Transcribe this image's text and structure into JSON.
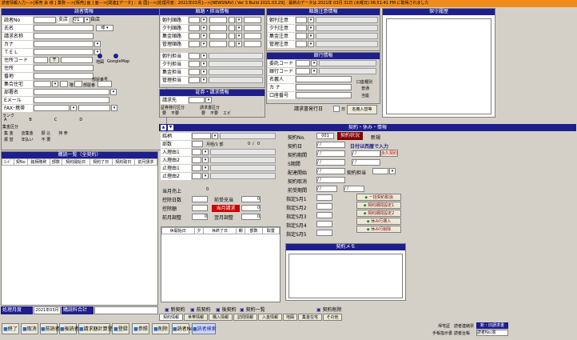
{
  "titlebar": "読者情報入力--->[販売 会 様 ] 業務 --->[販売] 画 ] 面--->[関連][データ] ：会 国]--->[処理月度：2021年03月]--->[NEWSNAVI / Ver 3 Build 2021.03.29]　最新のデータは 2021年 03月 31日 (水曜日) 06:51:41 PM に取得されました",
  "reader_panel": {
    "header": "読者情報",
    "reader_no": "読者No",
    "branch": "支店",
    "branch_code": "01",
    "branch_name": "自店",
    "name": "氏名",
    "customer_name": "請求名称",
    "kana": "カナ",
    "tel": "ＴＥＬ",
    "address_code": "住所コード",
    "postal": "〒",
    "address": "住所",
    "lot": "番地",
    "apt": "集合住宅",
    "floor": "階",
    "room": "部屋番",
    "room_no": "部屋番号",
    "dept": "部署名",
    "email": "Eメール",
    "fax": "FAX･携帯",
    "googlemap": "GoogleMap",
    "address_sub": "地図",
    "rank": "ランク",
    "rank_opts": [
      "A",
      "B",
      "C",
      "D"
    ],
    "collect": "集金区分",
    "collect_opts": [
      "集 金",
      "店集金",
      "振 込",
      "持 参",
      "振 替",
      "年払い",
      "不 要"
    ]
  },
  "delivery_panel": {
    "header": "順路・担当情報",
    "rows": [
      "朝刊順路",
      "夕刊順路",
      "集金順路",
      "管理順路",
      "朝刊担当",
      "夕刊担当",
      "集金担当",
      "管理担当"
    ]
  },
  "notes_panel": {
    "header": "順路注意情報",
    "rows": [
      "朝刊注意",
      "夕刊注意",
      "集金注意",
      "管理注意"
    ]
  },
  "keep_panel": {
    "header": "保守履歴"
  },
  "bank_panel": {
    "header": "銀行情報",
    "rows": [
      "委託コード",
      "銀行コード",
      "名義人",
      "カ ナ",
      "口座番号"
    ],
    "acct_type": "口座種別",
    "acct_opts": [
      "普通",
      "当座"
    ]
  },
  "bill_panel": {
    "header": "証券・請求情報",
    "bill_to": "請求先",
    "sec_issue": "証券発行区分",
    "bill_type": "請求書区分",
    "opt_need": "要",
    "opt_no": "不要",
    "opt_ebi": "エビ",
    "bill_issue_day": "請求書発行日",
    "day": "日",
    "name_input": "名義入替等"
  },
  "contract_header": "契約・休み・情報",
  "contract": {
    "brand": "銘柄",
    "dept": "部数",
    "monthly": "月極/1 部",
    "zero_a": "0",
    "slash": "/",
    "zero_b": "0",
    "in1": "入理由1",
    "in2": "入理由2",
    "stop1": "止理由1",
    "stop2": "止理由2",
    "current_sales": "当月売上",
    "current_val": "0",
    "deduct_days": "控除日数",
    "prev_pay": "前受充当",
    "prev_val": "0",
    "deduct_amt": "控除額",
    "current_bill": "当月請求",
    "bill_val": "0",
    "prev_adj": "前月調整",
    "prev_adj_val": "0",
    "next_adj": "翌月調整",
    "next_adj_val": "0"
  },
  "contract_right": {
    "contract_no": "契約No.",
    "no_val": "001",
    "status": "契約状況",
    "new": "新規",
    "date": "契約日",
    "date_val": "/ /",
    "hint": "日付は西暦で入力",
    "period": "契約期間",
    "s_period": "S期間",
    "delivery_start": "配達開始",
    "contract_cancel": "契約取消",
    "prev_period": "前受期間",
    "staff": "契約担当",
    "permanent": "永久契約",
    "months": [
      "指定S月1",
      "指定S月2",
      "指定S月3",
      "指定S月4",
      "指定S月5"
    ],
    "actions": [
      "一括契約取消",
      "契約期間設定1",
      "契約期間設定2",
      "休み行挿入",
      "休み行削除"
    ],
    "memo": "契約メモ"
  },
  "holiday_table": {
    "cols": [
      "休開始日",
      "夕",
      "休終了日",
      "朝",
      "部数",
      "取置"
    ]
  },
  "purchase_panel": {
    "header": "購読一覧（全契約）",
    "cols": [
      "ｺｰﾄﾞ",
      "契No",
      "銘柄略称",
      "部数",
      "契約開始日",
      "契約了日",
      "契約取日",
      "前月請求"
    ]
  },
  "bottom_info": {
    "month_label": "処理月度",
    "month_val": "2021年03月",
    "total": "購読料合計"
  },
  "contract_actions": [
    "新契約",
    "前契約",
    "後契約",
    "契約一覧",
    "契約削除"
  ],
  "tabs": [
    "契約情報",
    "世帯情報",
    "購入情報",
    "訪問情報",
    "入金情報",
    "地図",
    "集金在宅",
    "その他"
  ],
  "footer_buttons": [
    "終了",
    "取消",
    "前読者",
    "後読者",
    "請求額計算登録",
    "登録",
    "参照",
    "削除",
    "読者No",
    "読者検索"
  ],
  "footer_right": {
    "label1": "帰宅証",
    "label2": "手帳指示書",
    "label3": "読者連絡票",
    "label4": "読者台帳",
    "label5": "読者No.順",
    "btn": "新・旧請求書"
  },
  "colors": {
    "navy": "#1e1e8c",
    "orange": "#f08c1e",
    "red": "#c00000"
  }
}
